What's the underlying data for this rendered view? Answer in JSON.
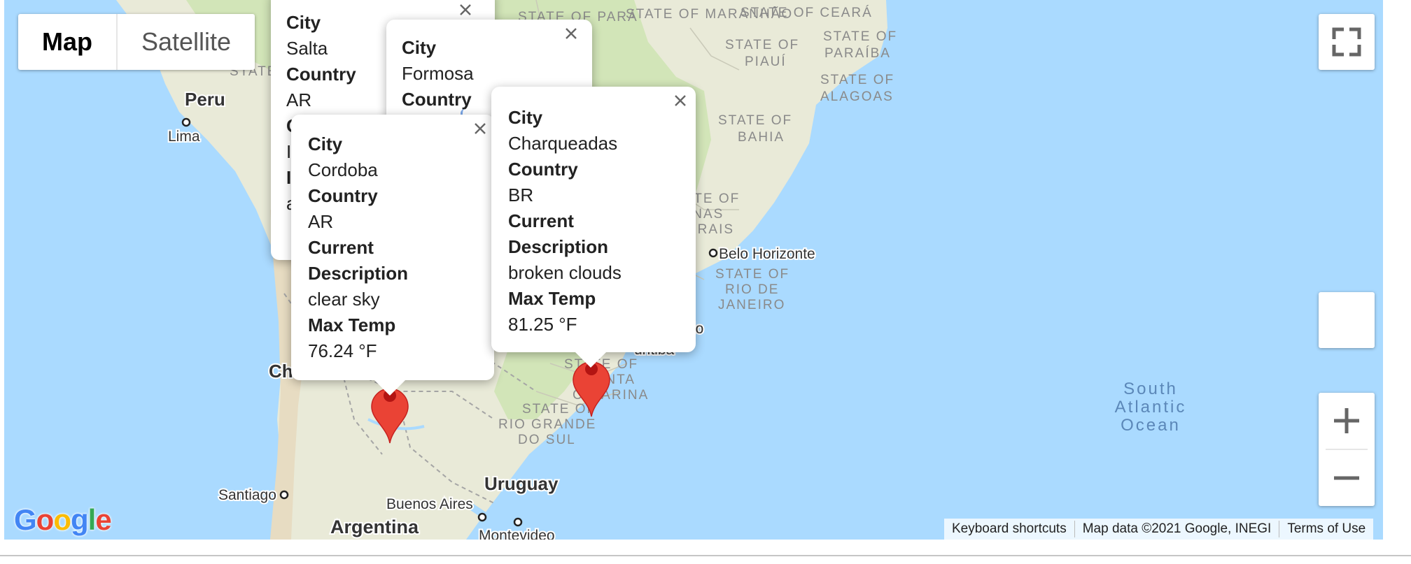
{
  "map_type_control": {
    "map_label": "Map",
    "satellite_label": "Satellite",
    "active": "Map"
  },
  "labels": {
    "peru": "Peru",
    "lima": "Lima",
    "para": "STATE OF PARÁ",
    "maranhao": "STATE OF MARANHÃO",
    "ceara": "STATE OF CEARÁ",
    "piaui": "STATE OF PIAUÍ",
    "paraiba": "STATE OF PARAÍBA",
    "alagoas": "STATE OF ALAGOAS",
    "bahia": "STATE OF BAHIA",
    "minas": "STATE OF MINAS GERAIS",
    "belo_horizonte": "Belo Horizonte",
    "rio": "STATE OF RIO DE JANEIRO",
    "sao_paulo_tail": "lo",
    "curitiba_tail": "uritiba",
    "santa_catarina": "STATE OF SANTA CATARINA",
    "rio_grande": "STATE OF RIO GRANDE DO SUL",
    "uruguay": "Uruguay",
    "buenos_aires": "Buenos Aires",
    "montevideo": "Montevideo",
    "argentina": "Argentina",
    "santiago": "Santiago",
    "chile_partial": "Ch",
    "state_partial": "STATE",
    "ocean": "South Atlantic Ocean",
    "ocean_1": "South",
    "ocean_2": "Atlantic",
    "ocean_3": "Ocean"
  },
  "info_windows": [
    {
      "id": "salta",
      "fields": [
        {
          "label": "City",
          "value": "Salta"
        },
        {
          "label": "Country",
          "value": "AR"
        }
      ],
      "hidden_partial": [
        "C",
        "I",
        "I",
        "a"
      ]
    },
    {
      "id": "formosa",
      "fields": [
        {
          "label": "City",
          "value": "Formosa"
        },
        {
          "label": "Country",
          "value": ""
        }
      ]
    },
    {
      "id": "cordoba",
      "fields": [
        {
          "label": "City",
          "value": "Cordoba"
        },
        {
          "label": "Country",
          "value": "AR"
        },
        {
          "label": "Current Description",
          "value": "clear sky"
        },
        {
          "label": "Max Temp",
          "value": "76.24 °F"
        }
      ]
    },
    {
      "id": "charqueadas",
      "fields": [
        {
          "label": "City",
          "value": "Charqueadas"
        },
        {
          "label": "Country",
          "value": "BR"
        },
        {
          "label": "Current Description",
          "value": "broken clouds"
        },
        {
          "label": "Max Temp",
          "value": "81.25 °F"
        }
      ]
    }
  ],
  "footer": {
    "shortcuts": "Keyboard shortcuts",
    "attribution": "Map data ©2021 Google, INEGI",
    "terms": "Terms of Use"
  },
  "logo": {
    "letters": [
      "G",
      "o",
      "o",
      "g",
      "l",
      "e"
    ],
    "colors": [
      "#4285F4",
      "#EA4335",
      "#FBBC05",
      "#4285F4",
      "#34A853",
      "#EA4335"
    ]
  },
  "colors": {
    "ocean": "#aadaff",
    "land": "#e8ead6",
    "forest": "#cfe3b4",
    "dry": "#f1ead6",
    "marker": "#ea4335",
    "marker_dark": "#b31412",
    "border": "#9a9a9a"
  },
  "icons": {
    "fullscreen": "fullscreen-icon",
    "zoom_in": "plus-icon",
    "zoom_out": "minus-icon",
    "close": "close-icon",
    "marker": "map-pin-icon"
  }
}
